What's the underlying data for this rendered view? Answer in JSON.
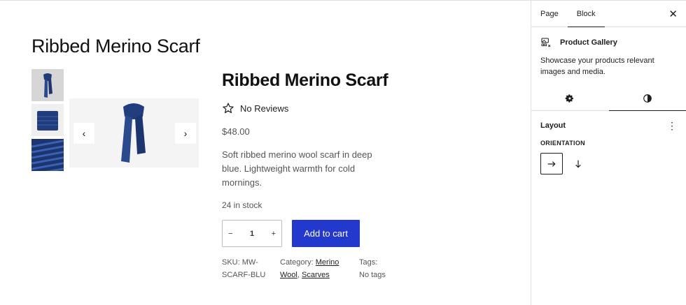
{
  "page": {
    "title": "Ribbed Merino Scarf"
  },
  "gallery": {
    "thumbnails": [
      "scarf-thumbnail-hanging",
      "scarf-thumbnail-folded",
      "scarf-thumbnail-knit-detail"
    ],
    "prev_icon": "chevron-left-icon",
    "next_icon": "chevron-right-icon"
  },
  "product": {
    "title": "Ribbed Merino Scarf",
    "reviews": "No Reviews",
    "price": "$48.00",
    "description": "Soft ribbed merino wool scarf in deep blue. Lightweight warmth for cold mornings.",
    "stock": "24 in stock",
    "quantity": "1",
    "qty_minus": "−",
    "qty_plus": "+",
    "add_to_cart": "Add to cart",
    "sku_label": "SKU:",
    "sku_value": "MW-SCARF-BLU",
    "category_label": "Category:",
    "categories": [
      "Merino Wool",
      "Scarves"
    ],
    "category_sep": ", ",
    "tags_label": "Tags:",
    "tags_value": "No tags"
  },
  "sidebar": {
    "tabs": [
      "Page",
      "Block"
    ],
    "active_tab": "Block",
    "close_icon": "close-icon",
    "block_name": "Product Gallery",
    "block_description": "Showcase your products relevant images and media.",
    "layout_title": "Layout",
    "orientation_label": "ORIENTATION"
  },
  "colors": {
    "accent": "#2338cc",
    "scarf": "#1f3a78",
    "text": "#1e1e1e",
    "muted": "#555555"
  }
}
